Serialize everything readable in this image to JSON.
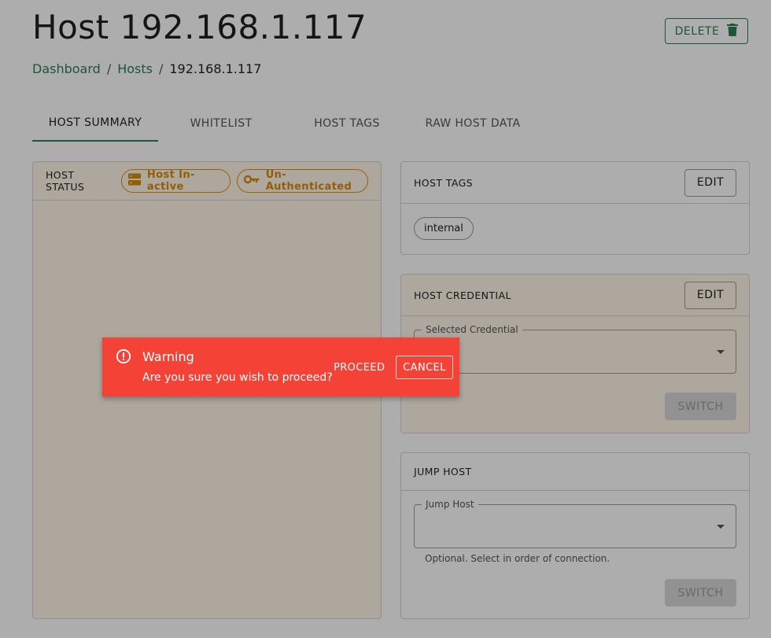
{
  "header": {
    "title": "Host 192.168.1.117",
    "delete_label": "DELETE",
    "delete_icon": "trash-icon"
  },
  "breadcrumb": {
    "items": [
      "Dashboard",
      "Hosts",
      "192.168.1.117"
    ],
    "separator": "/"
  },
  "tabs": [
    {
      "label": "HOST SUMMARY",
      "active": true
    },
    {
      "label": "WHITELIST",
      "active": false
    },
    {
      "label": "HOST TAGS",
      "active": false
    },
    {
      "label": "RAW HOST DATA",
      "active": false
    }
  ],
  "host_status": {
    "heading": "HOST STATUS",
    "chips": [
      {
        "label": "Host In-active",
        "icon": "server-icon"
      },
      {
        "label": "Un-Authenticated",
        "icon": "key-icon"
      }
    ]
  },
  "host_tags": {
    "heading": "HOST TAGS",
    "edit_label": "EDIT",
    "tags": [
      "internal"
    ]
  },
  "host_credential": {
    "heading": "HOST CREDENTIAL",
    "edit_label": "EDIT",
    "select_label": "Selected Credential",
    "select_value": "",
    "switch_label": "SWITCH"
  },
  "jump_host": {
    "heading": "JUMP HOST",
    "select_label": "Jump Host",
    "select_value": "",
    "helper": "Optional. Select in order of connection.",
    "switch_label": "SWITCH"
  },
  "snackbar": {
    "title": "Warning",
    "message": "Are you sure you wish to proceed?",
    "proceed_label": "PROCEED",
    "cancel_label": "CANCEL",
    "icon": "alert-circle-icon"
  },
  "colors": {
    "accent": "#2e7d52",
    "warning": "#f44336",
    "status": "#e0900a"
  }
}
